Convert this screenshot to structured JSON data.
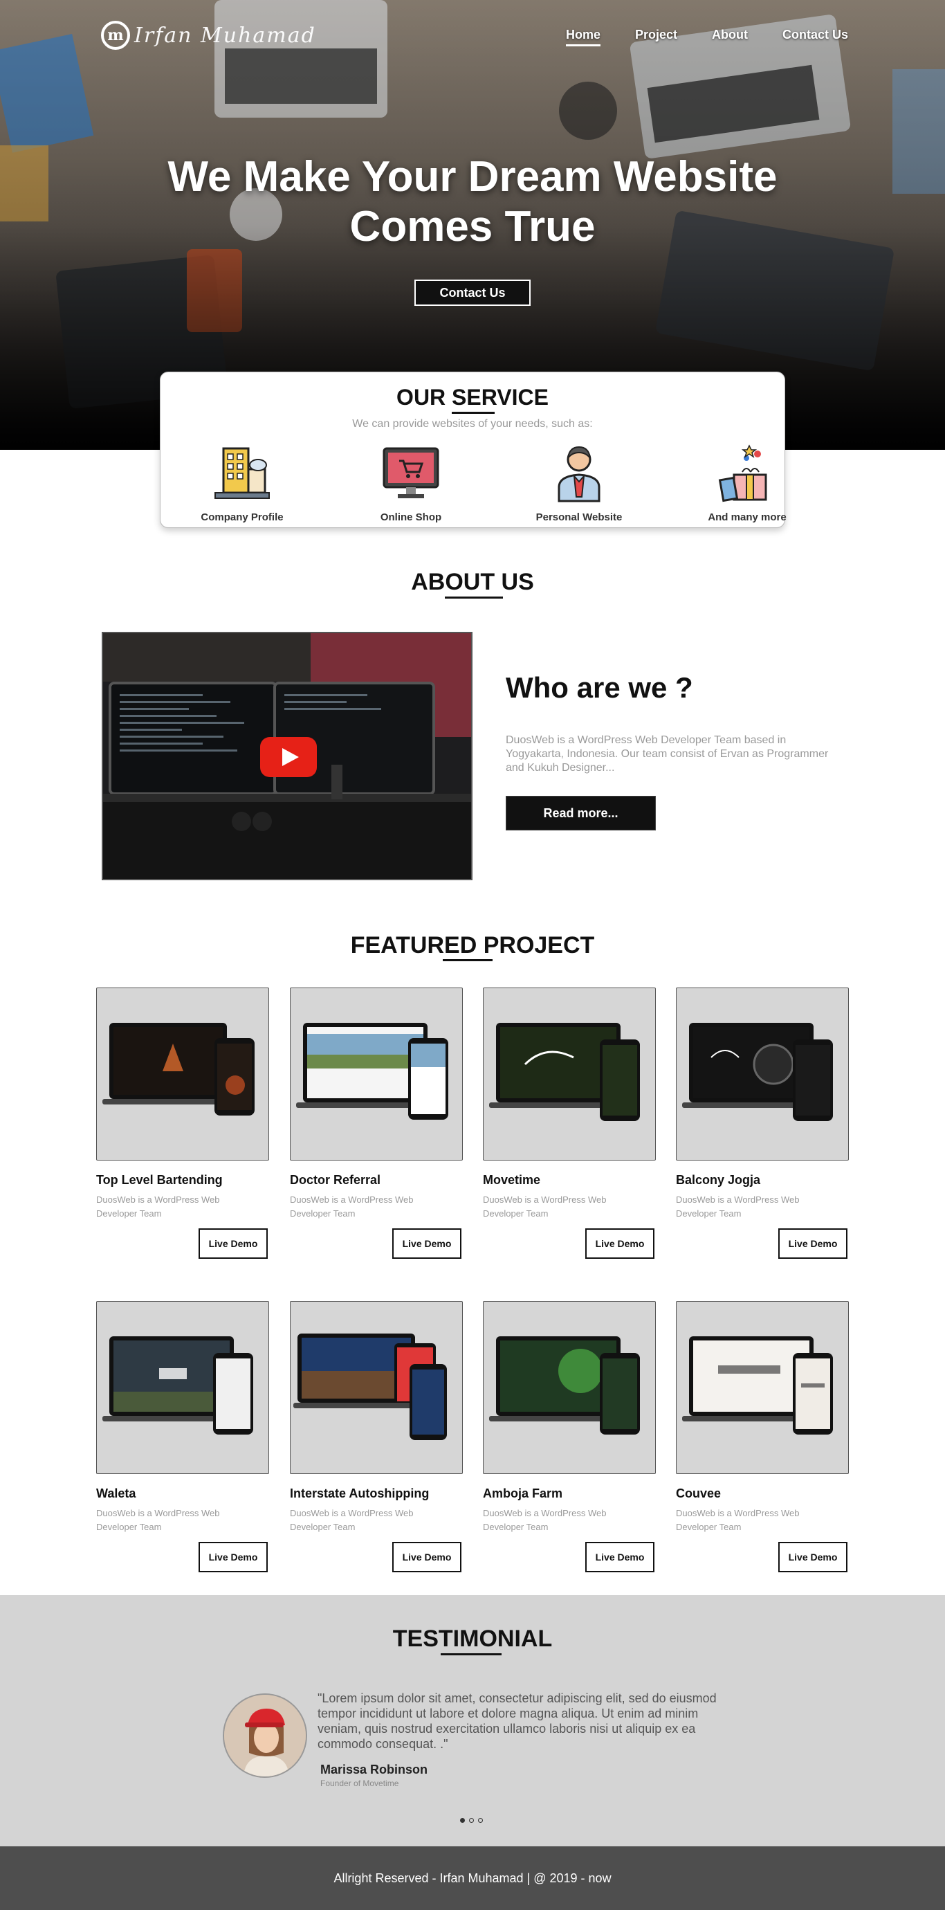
{
  "brand": {
    "mark": "m",
    "script": "Irfan Muhamad"
  },
  "nav": [
    "Home",
    "Project",
    "About",
    "Contact Us"
  ],
  "hero": {
    "title_line1": "We Make Your Dream Website",
    "title_line2": "Comes True",
    "button": "Contact Us"
  },
  "service": {
    "title": "OUR SERVICE",
    "subtitle": "We can provide websites of your needs, such as:",
    "items": [
      "Company Profile",
      "Online Shop",
      "Personal Website",
      "And many more"
    ]
  },
  "about": {
    "title": "ABOUT US",
    "heading": "Who are we ?",
    "text": "DuosWeb is a WordPress Web Developer Team based in Yogyakarta, Indonesia. Our team consist of Ervan as Programmer and Kukuh Designer...",
    "button": "Read more..."
  },
  "projects": {
    "title": "FEATURED PROJECT",
    "demo_label": "Live Demo",
    "desc": "DuosWeb is a WordPress Web Developer Team",
    "items": [
      "Top Level Bartending",
      "Doctor Referral",
      "Movetime",
      "Balcony Jogja",
      "Waleta",
      "Interstate Autoshipping",
      "Amboja Farm",
      "Couvee"
    ]
  },
  "testimonial": {
    "title": "TESTIMONIAL",
    "quote": "\"Lorem ipsum dolor sit amet, consectetur adipiscing elit, sed do eiusmod tempor incididunt ut labore et dolore magna aliqua. Ut enim ad minim veniam, quis nostrud exercitation ullamco laboris nisi ut aliquip ex ea commodo consequat. .\"",
    "name": "Marissa Robinson",
    "role": "Founder of Movetime"
  },
  "footer": "Allright Reserved - Irfan Muhamad | @ 2019 - now"
}
